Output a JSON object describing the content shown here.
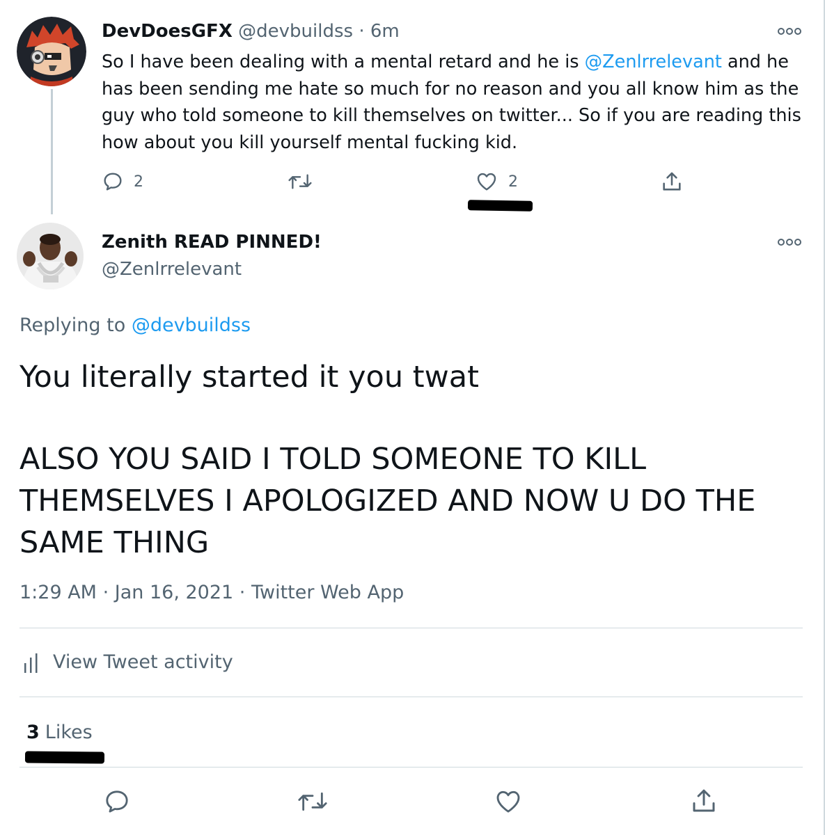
{
  "parent_tweet": {
    "display_name": "DevDoesGFX",
    "handle": "@devbuildss",
    "separator": "·",
    "time": "6m",
    "text_before": "So I have been dealing with a mental retard and he is ",
    "mention": "@Zenlrrelevant",
    "text_after": " and he has been sending me hate so much for no reason and you all know him as the guy who told someone to kill themselves on twitter... So if you are reading this how about you kill yourself mental fucking kid.",
    "reply_count": "2",
    "like_count": "2",
    "actions": [
      "reply-icon",
      "retweet-icon",
      "like-icon",
      "share-icon"
    ]
  },
  "reply_tweet": {
    "display_name": "Zenith READ PINNED!",
    "handle": "@Zenlrrelevant",
    "replying_prefix": "Replying to",
    "replying_handle": "@devbuildss",
    "text_line1": "You literally started it you twat",
    "text_line2": "ALSO YOU SAID I TOLD SOMEONE TO KILL THEMSELVES I APOLOGIZED AND NOW U DO THE SAME THING",
    "time": "1:29 AM",
    "separator1": "·",
    "date": "Jan 16, 2021",
    "separator2": "·",
    "source": "Twitter Web App",
    "activity_label": "View Tweet activity",
    "likes_count": "3",
    "likes_label": "Likes",
    "actions": [
      "reply-icon",
      "retweet-icon",
      "like-icon",
      "share-icon"
    ]
  },
  "colors": {
    "link": "#1d9bf0",
    "text": "#0f1419",
    "secondary": "#536471",
    "divider": "#cfd9de",
    "redaction": "#000000"
  }
}
